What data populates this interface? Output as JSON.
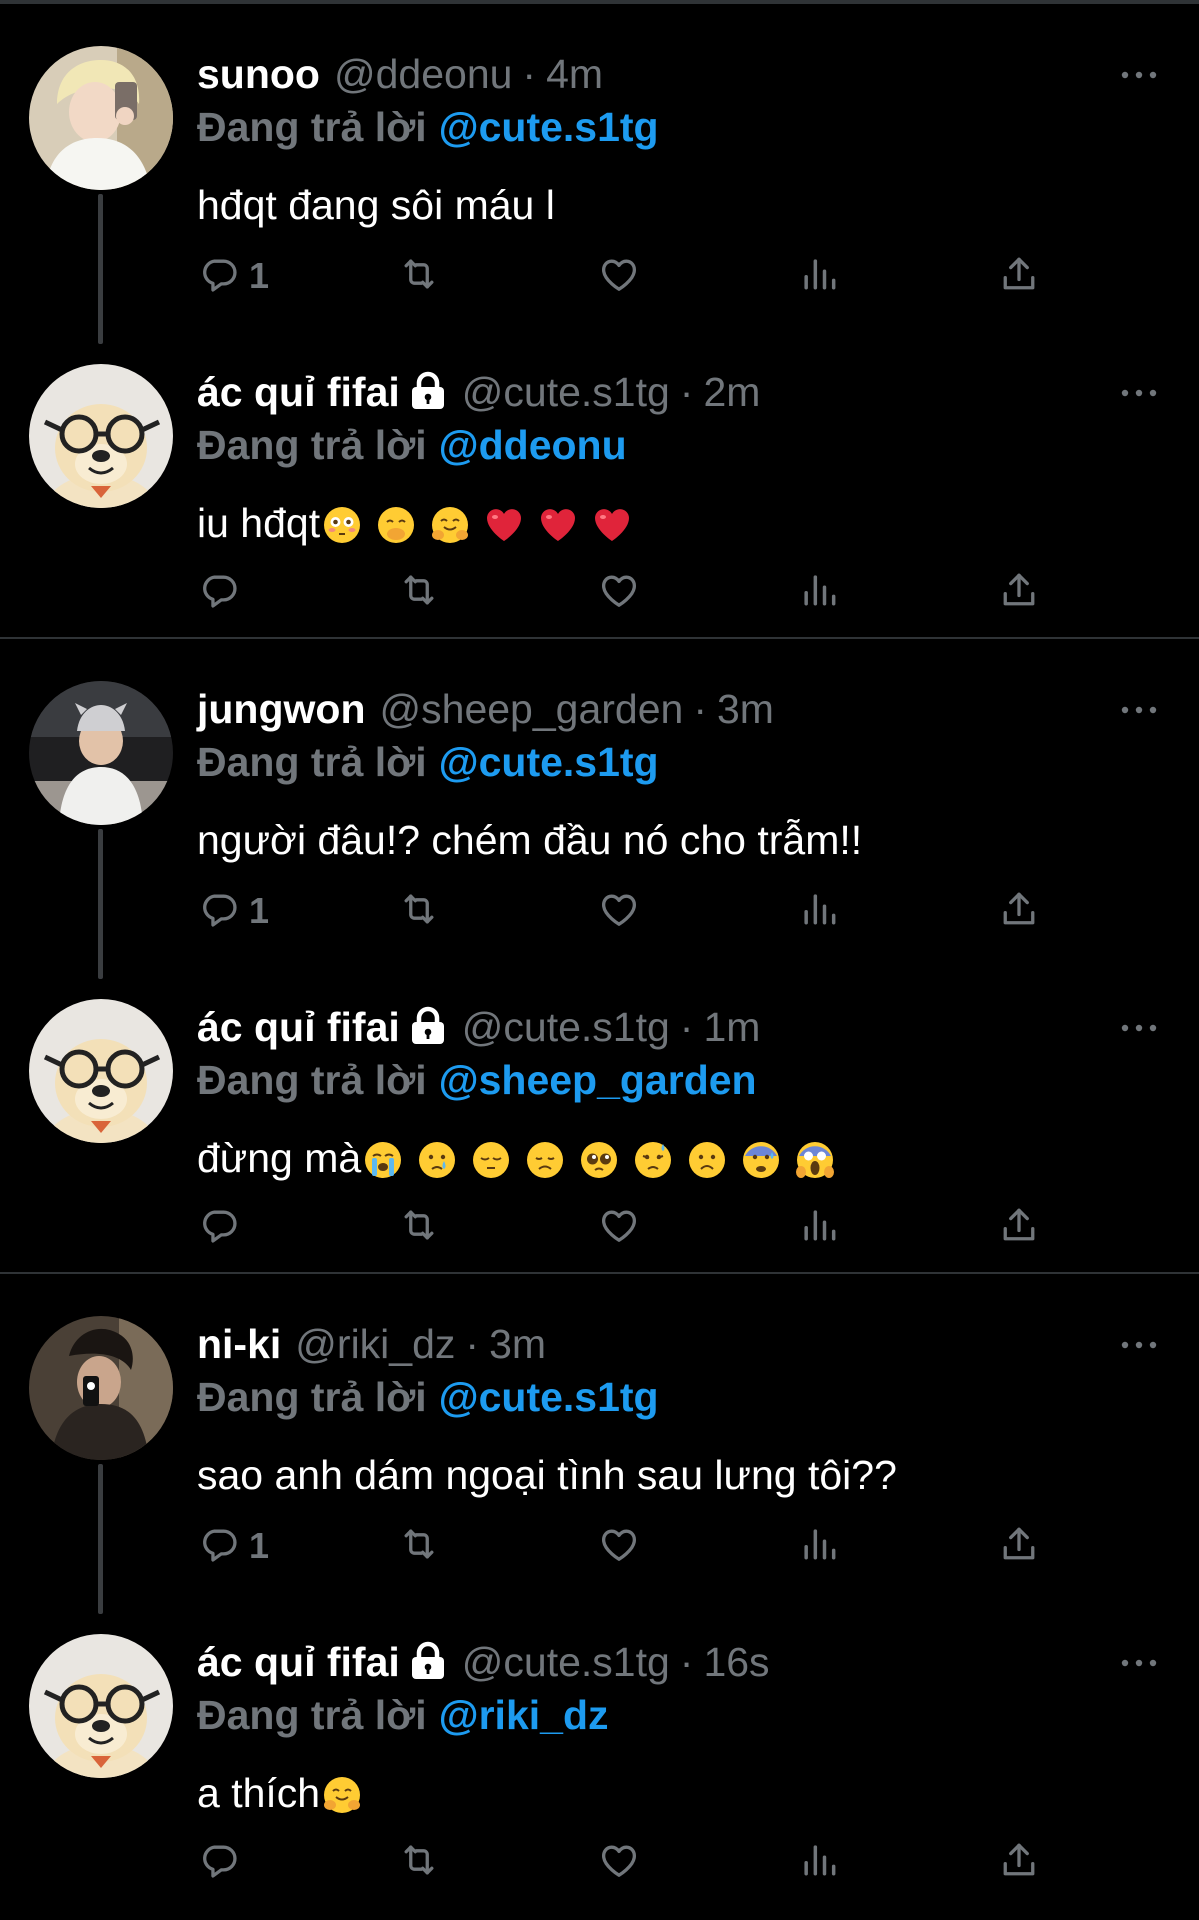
{
  "reply_prefix": "Đang trả lời",
  "threads": [
    {
      "first": {
        "name": "sunoo",
        "handle": "@ddeonu",
        "time": "4m",
        "reply_to": "@cute.s1tg",
        "text": "hđqt đang sôi máu l",
        "emojis": [],
        "reply_count": "1",
        "avatar": "sunoo-avatar"
      },
      "second": {
        "name": "ác quỉ fifai",
        "handle": "@cute.s1tg",
        "time": "2m",
        "reply_to": "@ddeonu",
        "text": "iu hđqt",
        "emojis": [
          "flushed",
          "hand-over-mouth",
          "hugging",
          "red-heart",
          "red-heart",
          "red-heart"
        ],
        "reply_count": "",
        "avatar": "dog-glasses-avatar",
        "locked": true
      }
    },
    {
      "first": {
        "name": "jungwon",
        "handle": "@sheep_garden",
        "time": "3m",
        "reply_to": "@cute.s1tg",
        "text": "người đâu!? chém đầu nó cho trẫm!!",
        "emojis": [],
        "reply_count": "1",
        "avatar": "jungwon-avatar"
      },
      "second": {
        "name": "ác quỉ fifai",
        "handle": "@cute.s1tg",
        "time": "1m",
        "reply_to": "@sheep_garden",
        "text": "đừng mà",
        "emojis": [
          "loudly-crying",
          "crying",
          "pensive",
          "disappointed",
          "pleading",
          "sad-relieved",
          "frowning",
          "anxious-sweat",
          "screaming"
        ],
        "reply_count": "",
        "avatar": "dog-glasses-avatar",
        "locked": true
      }
    },
    {
      "first": {
        "name": "ni-ki",
        "handle": "@riki_dz",
        "time": "3m",
        "reply_to": "@cute.s1tg",
        "text": "sao anh dám ngoại tình sau lưng tôi??",
        "emojis": [],
        "reply_count": "1",
        "avatar": "niki-avatar"
      },
      "second": {
        "name": "ác quỉ fifai",
        "handle": "@cute.s1tg",
        "time": "16s",
        "reply_to": "@riki_dz",
        "text": "a thích",
        "emojis": [
          "hugging"
        ],
        "reply_count": "",
        "avatar": "dog-glasses-avatar",
        "locked": true
      }
    }
  ],
  "colors": {
    "background": "#000000",
    "link": "#1d9bf0",
    "muted": "#71767b",
    "divider": "#2f3336"
  },
  "icons": [
    "reply-icon",
    "retweet-icon",
    "like-icon",
    "views-icon",
    "share-icon",
    "more-icon",
    "lock-icon"
  ]
}
